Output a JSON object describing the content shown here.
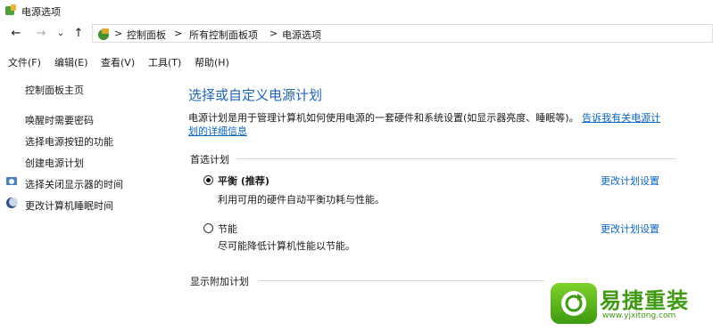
{
  "window": {
    "title": "电源选项"
  },
  "nav": {
    "back": "←",
    "forward": "→",
    "recent": "⌄",
    "up": "↑",
    "breadcrumb": [
      "控制面板",
      "所有控制面板项",
      "电源选项"
    ],
    "separator": ">"
  },
  "menu": [
    "文件(F)",
    "编辑(E)",
    "查看(V)",
    "工具(T)",
    "帮助(H)"
  ],
  "sidebar": {
    "home": "控制面板主页",
    "items": [
      "唤醒时需要密码",
      "选择电源按钮的功能",
      "创建电源计划",
      "选择关闭显示器的时间",
      "更改计算机睡眠时间"
    ]
  },
  "main": {
    "title": "选择或自定义电源计划",
    "desc": "电源计划是用于管理计算机如何使用电源的一套硬件和系统设置(如显示器亮度、睡眠等)。",
    "desc_link_1": "告诉我有关电源计",
    "desc_link_2": "划的详细信息",
    "preferred_header": "首选计划",
    "plans": [
      {
        "name": "平衡 (推荐)",
        "desc": "利用可用的硬件自动平衡功耗与性能。",
        "link": "更改计划设置",
        "selected": true
      },
      {
        "name": "节能",
        "desc": "尽可能降低计算机性能以节能。",
        "link": "更改计划设置",
        "selected": false
      }
    ],
    "additional_header": "显示附加计划"
  },
  "watermark": {
    "brand": "易捷重装",
    "url": "www.yjxitong.com"
  },
  "colors": {
    "heading": "#1e64b4",
    "link": "#0a66c2",
    "brand_green": "#3e9a10"
  }
}
